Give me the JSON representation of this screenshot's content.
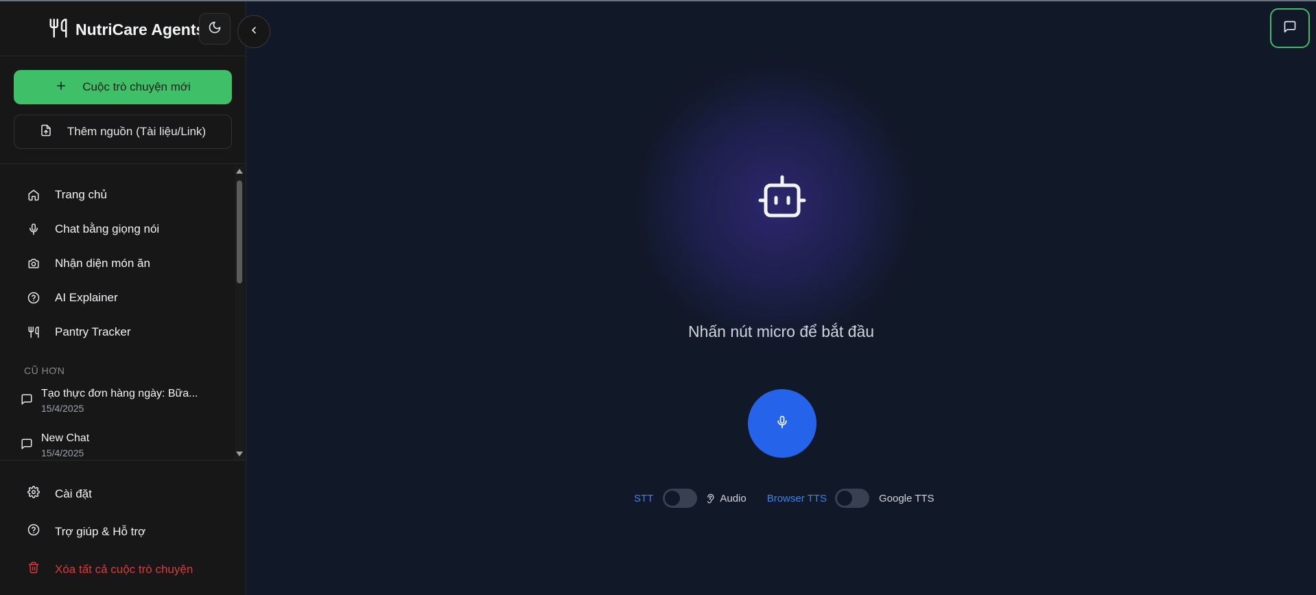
{
  "brand": {
    "name": "NutriCare Agents",
    "icon": "utensils-icon"
  },
  "sidebar": {
    "new_chat_label": "Cuộc trò chuyện mới",
    "add_source_label": "Thêm nguồn (Tài liệu/Link)",
    "nav": [
      {
        "label": "Trang chủ",
        "icon": "home-icon"
      },
      {
        "label": "Chat bằng giọng nói",
        "icon": "mic-icon"
      },
      {
        "label": "Nhận diện món ăn",
        "icon": "camera-icon"
      },
      {
        "label": "AI Explainer",
        "icon": "help-circle-icon"
      },
      {
        "label": "Pantry Tracker",
        "icon": "utensils-icon"
      }
    ],
    "section_older": "CŨ HƠN",
    "conversations": [
      {
        "title": "Tạo thực đơn hàng ngày: Bữa...",
        "date": "15/4/2025"
      },
      {
        "title": "New Chat",
        "date": "15/4/2025"
      }
    ],
    "bottom": {
      "settings": "Cài đặt",
      "help": "Trợ giúp & Hỗ trợ",
      "delete_all": "Xóa tất cả cuộc trò chuyện"
    }
  },
  "main": {
    "prompt": "Nhấn nút micro để bắt đầu",
    "controls": {
      "stt": "STT",
      "audio": "Audio",
      "browser_tts": "Browser TTS",
      "google_tts": "Google TTS"
    }
  },
  "colors": {
    "accent_green": "#3fbf68",
    "mic_blue": "#2563eb",
    "danger_red": "#dc3a3a",
    "background": "#111827",
    "sidebar_bg": "#171717"
  }
}
